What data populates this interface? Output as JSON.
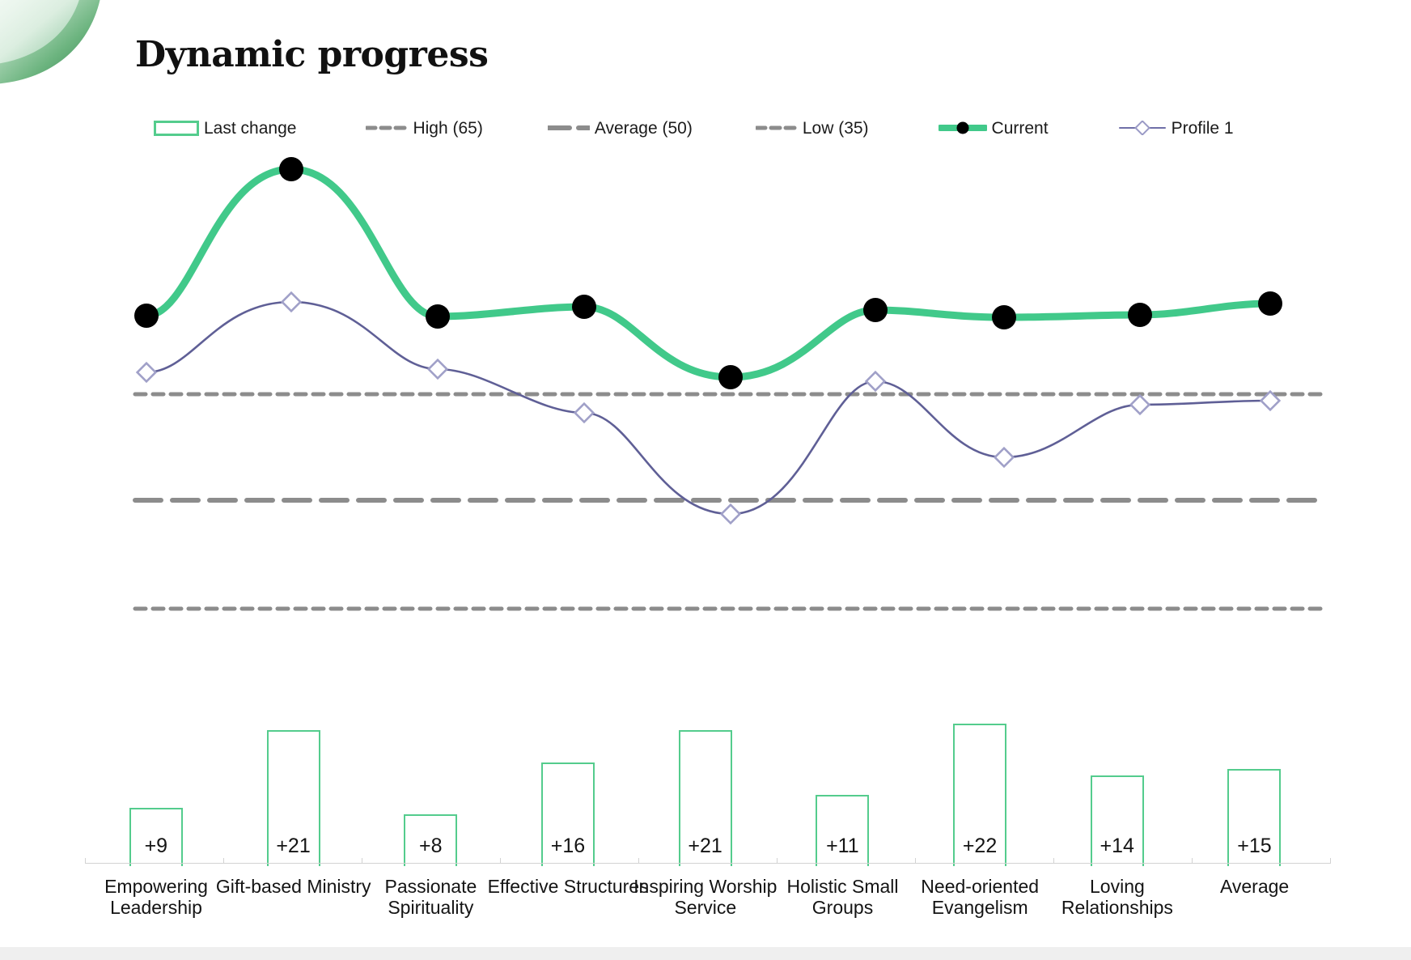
{
  "header": {
    "title": "Dynamic progress",
    "logo_icon": "leaf-logo"
  },
  "legend": {
    "items": [
      {
        "label": "Last change",
        "type": "bar-outline",
        "color": "#54cc8d"
      },
      {
        "label": "High (65)",
        "type": "dashed-line",
        "color": "#8c8c8c"
      },
      {
        "label": "Average (50)",
        "type": "long-dashed-line",
        "color": "#8c8c8c"
      },
      {
        "label": "Low (35)",
        "type": "dashed-line",
        "color": "#8c8c8c"
      },
      {
        "label": "Current",
        "type": "line-marker-circle",
        "color": "#41c98a"
      },
      {
        "label": "Profile 1",
        "type": "line-marker-diamond",
        "color": "#6f6fa8"
      }
    ]
  },
  "chart_data": {
    "type": "line",
    "title": "Dynamic progress",
    "xlabel": "",
    "ylabel": "",
    "ylim": [
      20,
      105
    ],
    "grid": false,
    "legend_position": "top",
    "categories": [
      "Empowering Leadership",
      "Gift-based Ministry",
      "Passionate Spirituality",
      "Effective Structures",
      "Inspiring Worship Service",
      "Holistic Small Groups",
      "Need-oriented Evangelism",
      "Loving Relationships",
      "Average"
    ],
    "series": [
      {
        "name": "Current",
        "type": "line",
        "color": "#41c98a",
        "marker": "circle",
        "marker_color": "#000000",
        "values": [
          76,
          96,
          76,
          77,
          67,
          77,
          76,
          76,
          78
        ]
      },
      {
        "name": "Profile 1",
        "type": "line",
        "color": "#6f6fa8",
        "marker": "diamond",
        "marker_color": "#a0a0c8",
        "values": [
          68,
          78,
          68,
          62,
          48,
          67,
          56,
          63,
          63
        ]
      },
      {
        "name": "Last change",
        "type": "bar",
        "color": "#54cc8d",
        "values": [
          9,
          21,
          8,
          16,
          21,
          11,
          22,
          14,
          15
        ],
        "value_labels": [
          "+9",
          "+21",
          "+8",
          "+16",
          "+21",
          "+11",
          "+22",
          "+14",
          "+15"
        ]
      }
    ],
    "reference_lines": [
      {
        "name": "High",
        "label": "High (65)",
        "value": 65,
        "style": "dashed",
        "color": "#8c8c8c"
      },
      {
        "name": "Average",
        "label": "Average (50)",
        "value": 50,
        "style": "long-dashed",
        "color": "#8c8c8c"
      },
      {
        "name": "Low",
        "label": "Low (35)",
        "value": 35,
        "style": "dashed",
        "color": "#8c8c8c"
      }
    ]
  },
  "colors": {
    "accent_green": "#54cc8d",
    "current_line": "#41c98a",
    "profile_line": "#6f6fa8",
    "reference_line": "#8c8c8c",
    "marker_black": "#000000",
    "axis": "#d2d2d2"
  }
}
